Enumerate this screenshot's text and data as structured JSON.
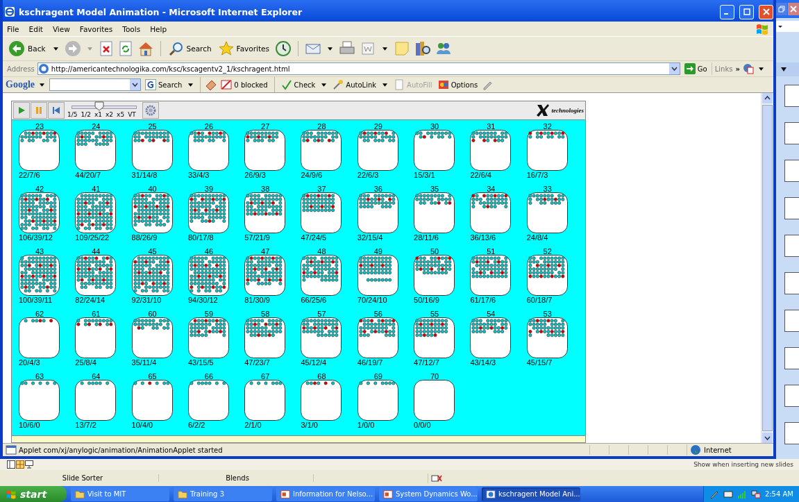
{
  "window": {
    "title": "kschragent Model Animation - Microsoft Internet Explorer"
  },
  "menu": [
    "File",
    "Edit",
    "View",
    "Favorites",
    "Tools",
    "Help"
  ],
  "toolbar": {
    "back": "Back",
    "search": "Search",
    "favorites": "Favorites"
  },
  "address": {
    "label": "Address",
    "url": "http://americantechnologika.com/ksc/kscagentv2_1/kschragent.html",
    "go": "Go",
    "links": "Links",
    "more": "»"
  },
  "google_bar": {
    "logo": "Google",
    "search": "Search",
    "blocked": "0 blocked",
    "check": "Check",
    "autolink": "AutoLink",
    "autofill": {
      "label": "AutoFill",
      "disabled": true
    },
    "options": "Options"
  },
  "applet": {
    "speeds": [
      "1/5",
      "1/2",
      "x1",
      "x2",
      "x5",
      "VT"
    ],
    "speed_slider": {
      "level": 0.43
    },
    "logo": "technologies",
    "rows": [
      [
        {
          "number": "23",
          "reading": "22/7/6"
        },
        {
          "number": "24",
          "reading": "44/20/7"
        },
        {
          "number": "25",
          "reading": "31/14/8"
        },
        {
          "number": "26",
          "reading": "33/4/3"
        },
        {
          "number": "27",
          "reading": "26/9/3"
        },
        {
          "number": "28",
          "reading": "24/9/6"
        },
        {
          "number": "29",
          "reading": "22/6/3"
        },
        {
          "number": "30",
          "reading": "15/3/1"
        },
        {
          "number": "31",
          "reading": "22/6/4"
        },
        {
          "number": "32",
          "reading": "16/7/3"
        }
      ],
      [
        {
          "number": "42",
          "reading": "106/39/12"
        },
        {
          "number": "41",
          "reading": "109/25/22"
        },
        {
          "number": "40",
          "reading": "88/26/9"
        },
        {
          "number": "39",
          "reading": "80/17/8"
        },
        {
          "number": "38",
          "reading": "57/21/9"
        },
        {
          "number": "37",
          "reading": "47/24/5"
        },
        {
          "number": "36",
          "reading": "32/15/4"
        },
        {
          "number": "35",
          "reading": "28/11/6"
        },
        {
          "number": "34",
          "reading": "36/13/6"
        },
        {
          "number": "33",
          "reading": "24/8/4"
        }
      ],
      [
        {
          "number": "43",
          "reading": "100/39/11"
        },
        {
          "number": "44",
          "reading": "82/24/14"
        },
        {
          "number": "45",
          "reading": "92/31/10"
        },
        {
          "number": "46",
          "reading": "94/30/12"
        },
        {
          "number": "47",
          "reading": "81/30/9"
        },
        {
          "number": "48",
          "reading": "66/25/6"
        },
        {
          "number": "49",
          "reading": "70/24/10"
        },
        {
          "number": "50",
          "reading": "50/16/9"
        },
        {
          "number": "51",
          "reading": "61/17/6"
        },
        {
          "number": "52",
          "reading": "60/18/7"
        }
      ],
      [
        {
          "number": "62",
          "reading": "20/4/3"
        },
        {
          "number": "61",
          "reading": "25/8/4"
        },
        {
          "number": "60",
          "reading": "35/11/4"
        },
        {
          "number": "59",
          "reading": "43/15/5"
        },
        {
          "number": "58",
          "reading": "47/23/7"
        },
        {
          "number": "57",
          "reading": "45/12/4"
        },
        {
          "number": "56",
          "reading": "46/19/7"
        },
        {
          "number": "55",
          "reading": "47/12/7"
        },
        {
          "number": "54",
          "reading": "43/14/3"
        },
        {
          "number": "53",
          "reading": "45/15/7"
        }
      ],
      [
        {
          "number": "63",
          "reading": "10/6/0"
        },
        {
          "number": "64",
          "reading": "13/7/2"
        },
        {
          "number": "65",
          "reading": "10/4/0"
        },
        {
          "number": "66",
          "reading": "6/2/2"
        },
        {
          "number": "67",
          "reading": "2/1/0"
        },
        {
          "number": "68",
          "reading": "3/1/0"
        },
        {
          "number": "69",
          "reading": "1/0/0"
        },
        {
          "number": "70",
          "reading": "0/0/0"
        }
      ]
    ]
  },
  "status_bar": {
    "text": "Applet com/xj/anylogic/animation/AnimationApplet started",
    "zone": "Internet"
  },
  "background_app": {
    "hint": "Show when inserting new slides",
    "status": [
      "Slide Sorter",
      "Blends"
    ]
  },
  "taskbar": {
    "start": "start",
    "tasks": [
      {
        "label": "Visit to MIT",
        "kind": "folder",
        "selected": false
      },
      {
        "label": "Training 3",
        "kind": "folder",
        "selected": false
      },
      {
        "label": "Information for Nelso...",
        "kind": "slides",
        "selected": false
      },
      {
        "label": "System Dynamics Wo...",
        "kind": "slides",
        "selected": false
      },
      {
        "label": "kschragent Model Ani...",
        "kind": "browser",
        "selected": true
      }
    ],
    "clock": "2:54 AM"
  }
}
